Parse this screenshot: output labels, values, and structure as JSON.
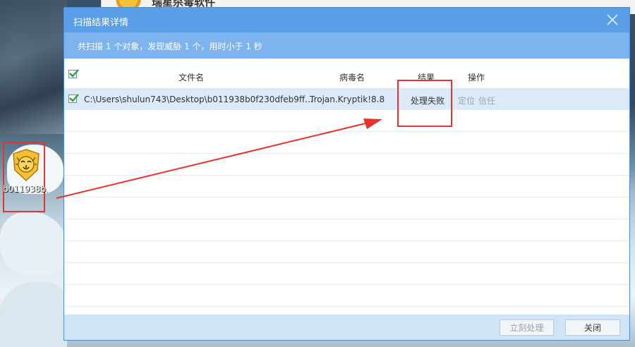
{
  "background_window": {
    "title_fragment": "瑞星杀毒软件"
  },
  "desktop": {
    "icon_label": "b011938b.."
  },
  "dialog": {
    "title": "扫描结果详情",
    "summary": "共扫描 1 个对象，发现威胁 1 个，用时小于 1 秒",
    "columns": {
      "filename": "文件名",
      "virus": "病毒名",
      "result": "结果",
      "action": "操作"
    },
    "rows": [
      {
        "path": "C:\\Users\\shulun743\\Desktop\\b011938b0f230dfeb9ff...",
        "virus": "Trojan.Kryptik!8.8",
        "result": "处理失败",
        "locate": "定位",
        "trust": "信任",
        "checked": true
      }
    ],
    "buttons": {
      "process_now": "立刻处理",
      "close": "关闭"
    }
  },
  "colors": {
    "titlebar": "#5a9ee8",
    "summary_bar": "#7db3ef",
    "selected_row": "#dbe9f8",
    "annotation_red": "#e8332c",
    "check_green": "#2aa43b"
  }
}
